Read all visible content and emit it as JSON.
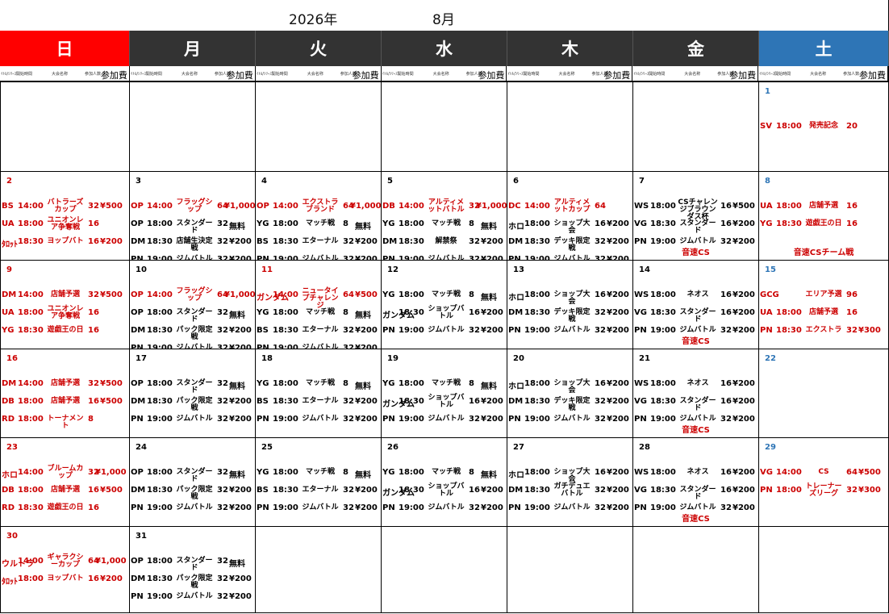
{
  "header": {
    "year": "2026年",
    "month": "8月"
  },
  "days": [
    {
      "label": "日",
      "style": "sun"
    },
    {
      "label": "月",
      "style": "wk"
    },
    {
      "label": "火",
      "style": "wk"
    },
    {
      "label": "水",
      "style": "wk"
    },
    {
      "label": "木",
      "style": "wk"
    },
    {
      "label": "金",
      "style": "wk"
    },
    {
      "label": "土",
      "style": "sat"
    }
  ],
  "subheader": {
    "c1": "ｲﾄﾙ/ｼﾘｰｽﾞ",
    "c2": "開始時間",
    "c3": "大会名称",
    "c4": "参加人数",
    "c5": "参加費"
  },
  "weeks": [
    [
      null,
      null,
      null,
      null,
      null,
      null,
      {
        "date": "1",
        "color": "blue",
        "events": [
          {
            "g": "SV",
            "t": "18:00",
            "n": "発売記念",
            "c": "20",
            "f": "",
            "color": "r"
          }
        ]
      }
    ],
    [
      {
        "date": "2",
        "color": "red",
        "events": [
          {
            "g": "BS",
            "t": "14:00",
            "n": "バトラーズカップ",
            "c": "32",
            "f": "¥500",
            "color": "r"
          },
          {
            "g": "UA",
            "t": "18:00",
            "n": "ユニオンレア争奪戦",
            "c": "16",
            "f": "",
            "color": "r"
          },
          {
            "g": "ﾀﾛｯﾄ",
            "t": "18:30",
            "n": "ヨップバト",
            "c": "16",
            "f": "¥200",
            "color": "r"
          }
        ]
      },
      {
        "date": "3",
        "color": "",
        "events": [
          {
            "g": "OP",
            "t": "14:00",
            "n": "フラッグシップ",
            "c": "64",
            "f": "¥1,000",
            "color": "r"
          },
          {
            "g": "OP",
            "t": "18:00",
            "n": "スタンダード",
            "c": "32",
            "f": "無料",
            "color": "k"
          },
          {
            "g": "DM",
            "t": "18:30",
            "n": "店舗生決定戦",
            "c": "32",
            "f": "¥200",
            "color": "k"
          },
          {
            "g": "PN",
            "t": "19:00",
            "n": "ジムバトル",
            "c": "32",
            "f": "¥200",
            "color": "k"
          }
        ]
      },
      {
        "date": "4",
        "color": "",
        "events": [
          {
            "g": "OP",
            "t": "14:00",
            "n": "エクストラブランド",
            "c": "64",
            "f": "¥1,000",
            "color": "r"
          },
          {
            "g": "YG",
            "t": "18:00",
            "n": "マッチ戦",
            "c": "8",
            "f": "無料",
            "color": "k"
          },
          {
            "g": "BS",
            "t": "18:30",
            "n": "エターナル",
            "c": "32",
            "f": "¥200",
            "color": "k"
          },
          {
            "g": "PN",
            "t": "19:00",
            "n": "ジムバトル",
            "c": "32",
            "f": "¥200",
            "color": "k"
          }
        ]
      },
      {
        "date": "5",
        "color": "",
        "events": [
          {
            "g": "DB",
            "t": "14:00",
            "n": "アルティメットバトル",
            "c": "32",
            "f": "¥1,000",
            "color": "r"
          },
          {
            "g": "YG",
            "t": "18:00",
            "n": "マッチ戦",
            "c": "8",
            "f": "無料",
            "color": "k"
          },
          {
            "g": "DM",
            "t": "18:30",
            "n": "解禁祭",
            "c": "32",
            "f": "¥200",
            "color": "k"
          },
          {
            "g": "PN",
            "t": "19:00",
            "n": "ジムバトル",
            "c": "32",
            "f": "¥200",
            "color": "k"
          }
        ]
      },
      {
        "date": "6",
        "color": "",
        "events": [
          {
            "g": "DC",
            "t": "14:00",
            "n": "アルティメットカップ",
            "c": "64",
            "f": "",
            "color": "r"
          },
          {
            "g": "ホロ",
            "t": "18:00",
            "n": "ショップ大会",
            "c": "16",
            "f": "¥200",
            "color": "k"
          },
          {
            "g": "DM",
            "t": "18:30",
            "n": "デッキ限定戦",
            "c": "32",
            "f": "¥200",
            "color": "k"
          },
          {
            "g": "PN",
            "t": "19:00",
            "n": "ジムバトル",
            "c": "32",
            "f": "¥200",
            "color": "k"
          }
        ]
      },
      {
        "date": "7",
        "color": "",
        "events": [
          {
            "g": "WS",
            "t": "18:00",
            "n": "CSチャレンジブラウンダス杯",
            "c": "16",
            "f": "¥500",
            "color": "k"
          },
          {
            "g": "VG",
            "t": "18:30",
            "n": "スタンダード",
            "c": "16",
            "f": "¥200",
            "color": "k"
          },
          {
            "g": "PN",
            "t": "19:00",
            "n": "ジムバトル",
            "c": "32",
            "f": "¥200",
            "color": "k"
          }
        ],
        "note": "音速CS"
      },
      {
        "date": "8",
        "color": "blue",
        "events": [
          {
            "g": "UA",
            "t": "18:00",
            "n": "店舗予選",
            "c": "16",
            "f": "",
            "color": "r"
          },
          {
            "g": "YG",
            "t": "18:30",
            "n": "遊戯王の日",
            "c": "16",
            "f": "",
            "color": "r"
          }
        ],
        "note": "音速CSチーム戦"
      }
    ],
    [
      {
        "date": "9",
        "color": "red",
        "events": [
          {
            "g": "DM",
            "t": "14:00",
            "n": "店舗予選",
            "c": "32",
            "f": "¥500",
            "color": "r"
          },
          {
            "g": "UA",
            "t": "18:00",
            "n": "ユニオンレア争奪戦",
            "c": "16",
            "f": "",
            "color": "r"
          },
          {
            "g": "YG",
            "t": "18:30",
            "n": "遊戯王の日",
            "c": "16",
            "f": "",
            "color": "r"
          }
        ]
      },
      {
        "date": "10",
        "color": "",
        "events": [
          {
            "g": "OP",
            "t": "14:00",
            "n": "フラッグシップ",
            "c": "64",
            "f": "¥1,000",
            "color": "r"
          },
          {
            "g": "OP",
            "t": "18:00",
            "n": "スタンダード",
            "c": "32",
            "f": "無料",
            "color": "k"
          },
          {
            "g": "DM",
            "t": "18:30",
            "n": "パック限定戦",
            "c": "32",
            "f": "¥200",
            "color": "k"
          },
          {
            "g": "PN",
            "t": "19:00",
            "n": "ジムバトル",
            "c": "32",
            "f": "¥200",
            "color": "k"
          }
        ]
      },
      {
        "date": "11",
        "color": "red",
        "events": [
          {
            "g": "ガンダム",
            "t": "14:00",
            "n": "ニュータイプチャレンジ",
            "c": "64",
            "f": "¥500",
            "color": "r"
          },
          {
            "g": "YG",
            "t": "18:00",
            "n": "マッチ戦",
            "c": "8",
            "f": "無料",
            "color": "k"
          },
          {
            "g": "BS",
            "t": "18:30",
            "n": "エターナル",
            "c": "32",
            "f": "¥200",
            "color": "k"
          },
          {
            "g": "PN",
            "t": "19:00",
            "n": "ジムバトル",
            "c": "32",
            "f": "¥200",
            "color": "k"
          }
        ]
      },
      {
        "date": "12",
        "color": "",
        "events": [
          {
            "g": "YG",
            "t": "18:00",
            "n": "マッチ戦",
            "c": "8",
            "f": "無料",
            "color": "k"
          },
          {
            "g": "ガンダム",
            "t": "18:30",
            "n": "ショップバトル",
            "c": "16",
            "f": "¥200",
            "color": "k"
          },
          {
            "g": "PN",
            "t": "19:00",
            "n": "ジムバトル",
            "c": "32",
            "f": "¥200",
            "color": "k"
          }
        ]
      },
      {
        "date": "13",
        "color": "",
        "events": [
          {
            "g": "ホロ",
            "t": "18:00",
            "n": "ショップ大会",
            "c": "16",
            "f": "¥200",
            "color": "k"
          },
          {
            "g": "DM",
            "t": "18:30",
            "n": "デッキ限定戦",
            "c": "32",
            "f": "¥200",
            "color": "k"
          },
          {
            "g": "PN",
            "t": "19:00",
            "n": "ジムバトル",
            "c": "32",
            "f": "¥200",
            "color": "k"
          }
        ]
      },
      {
        "date": "14",
        "color": "",
        "events": [
          {
            "g": "WS",
            "t": "18:00",
            "n": "ネオス",
            "c": "16",
            "f": "¥200",
            "color": "k"
          },
          {
            "g": "VG",
            "t": "18:30",
            "n": "スタンダード",
            "c": "16",
            "f": "¥200",
            "color": "k"
          },
          {
            "g": "PN",
            "t": "19:00",
            "n": "ジムバトル",
            "c": "32",
            "f": "¥200",
            "color": "k"
          }
        ],
        "note": "音速CS"
      },
      {
        "date": "15",
        "color": "blue",
        "events": [
          {
            "g": "GCG",
            "t": "",
            "n": "エリア予選",
            "c": "96",
            "f": "",
            "color": "r"
          },
          {
            "g": "UA",
            "t": "18:00",
            "n": "店舗予選",
            "c": "16",
            "f": "",
            "color": "r"
          },
          {
            "g": "PN",
            "t": "18:30",
            "n": "エクストラ",
            "c": "32",
            "f": "¥300",
            "color": "r"
          }
        ]
      }
    ],
    [
      {
        "date": "16",
        "color": "red",
        "events": [
          {
            "g": "DM",
            "t": "14:00",
            "n": "店舗予選",
            "c": "32",
            "f": "¥500",
            "color": "r"
          },
          {
            "g": "DB",
            "t": "18:00",
            "n": "店舗予選",
            "c": "16",
            "f": "¥500",
            "color": "r"
          },
          {
            "g": "RD",
            "t": "18:00",
            "n": "トーナメント",
            "c": "8",
            "f": "",
            "color": "r"
          }
        ]
      },
      {
        "date": "17",
        "color": "",
        "events": [
          {
            "g": "OP",
            "t": "18:00",
            "n": "スタンダード",
            "c": "32",
            "f": "無料",
            "color": "k"
          },
          {
            "g": "DM",
            "t": "18:30",
            "n": "パック限定戦",
            "c": "32",
            "f": "¥200",
            "color": "k"
          },
          {
            "g": "PN",
            "t": "19:00",
            "n": "ジムバトル",
            "c": "32",
            "f": "¥200",
            "color": "k"
          }
        ]
      },
      {
        "date": "18",
        "color": "",
        "events": [
          {
            "g": "YG",
            "t": "18:00",
            "n": "マッチ戦",
            "c": "8",
            "f": "無料",
            "color": "k"
          },
          {
            "g": "BS",
            "t": "18:30",
            "n": "エターナル",
            "c": "32",
            "f": "¥200",
            "color": "k"
          },
          {
            "g": "PN",
            "t": "19:00",
            "n": "ジムバトル",
            "c": "32",
            "f": "¥200",
            "color": "k"
          }
        ]
      },
      {
        "date": "19",
        "color": "",
        "events": [
          {
            "g": "YG",
            "t": "18:00",
            "n": "マッチ戦",
            "c": "8",
            "f": "無料",
            "color": "k"
          },
          {
            "g": "ガンダム",
            "t": "18:30",
            "n": "ショップバトル",
            "c": "16",
            "f": "¥200",
            "color": "k"
          },
          {
            "g": "PN",
            "t": "19:00",
            "n": "ジムバトル",
            "c": "32",
            "f": "¥200",
            "color": "k"
          }
        ]
      },
      {
        "date": "20",
        "color": "",
        "events": [
          {
            "g": "ホロ",
            "t": "18:00",
            "n": "ショップ大会",
            "c": "16",
            "f": "¥200",
            "color": "k"
          },
          {
            "g": "DM",
            "t": "18:30",
            "n": "デッキ限定戦",
            "c": "32",
            "f": "¥200",
            "color": "k"
          },
          {
            "g": "PN",
            "t": "19:00",
            "n": "ジムバトル",
            "c": "32",
            "f": "¥200",
            "color": "k"
          }
        ]
      },
      {
        "date": "21",
        "color": "",
        "events": [
          {
            "g": "WS",
            "t": "18:00",
            "n": "ネオス",
            "c": "16",
            "f": "¥200",
            "color": "k"
          },
          {
            "g": "VG",
            "t": "18:30",
            "n": "スタンダード",
            "c": "16",
            "f": "¥200",
            "color": "k"
          },
          {
            "g": "PN",
            "t": "19:00",
            "n": "ジムバトル",
            "c": "32",
            "f": "¥200",
            "color": "k"
          }
        ],
        "note": "音速CS"
      },
      {
        "date": "22",
        "color": "blue",
        "events": []
      }
    ],
    [
      {
        "date": "23",
        "color": "red",
        "events": [
          {
            "g": "ホロ",
            "t": "14:00",
            "n": "ブルームカップ",
            "c": "32",
            "f": "¥1,000",
            "color": "r"
          },
          {
            "g": "DB",
            "t": "18:00",
            "n": "店舗予選",
            "c": "16",
            "f": "¥500",
            "color": "r"
          },
          {
            "g": "RD",
            "t": "18:30",
            "n": "遊戯王の日",
            "c": "16",
            "f": "",
            "color": "r"
          }
        ]
      },
      {
        "date": "24",
        "color": "",
        "events": [
          {
            "g": "OP",
            "t": "18:00",
            "n": "スタンダード",
            "c": "32",
            "f": "無料",
            "color": "k"
          },
          {
            "g": "DM",
            "t": "18:30",
            "n": "パック限定戦",
            "c": "32",
            "f": "¥200",
            "color": "k"
          },
          {
            "g": "PN",
            "t": "19:00",
            "n": "ジムバトル",
            "c": "32",
            "f": "¥200",
            "color": "k"
          }
        ]
      },
      {
        "date": "25",
        "color": "",
        "events": [
          {
            "g": "YG",
            "t": "18:00",
            "n": "マッチ戦",
            "c": "8",
            "f": "無料",
            "color": "k"
          },
          {
            "g": "BS",
            "t": "18:30",
            "n": "エターナル",
            "c": "32",
            "f": "¥200",
            "color": "k"
          },
          {
            "g": "PN",
            "t": "19:00",
            "n": "ジムバトル",
            "c": "32",
            "f": "¥200",
            "color": "k"
          }
        ]
      },
      {
        "date": "26",
        "color": "",
        "events": [
          {
            "g": "YG",
            "t": "18:00",
            "n": "マッチ戦",
            "c": "8",
            "f": "無料",
            "color": "k"
          },
          {
            "g": "ガンダム",
            "t": "18:30",
            "n": "ショップバトル",
            "c": "16",
            "f": "¥200",
            "color": "k"
          },
          {
            "g": "PN",
            "t": "19:00",
            "n": "ジムバトル",
            "c": "32",
            "f": "¥200",
            "color": "k"
          }
        ]
      },
      {
        "date": "27",
        "color": "",
        "events": [
          {
            "g": "ホロ",
            "t": "18:00",
            "n": "ショップ大会",
            "c": "16",
            "f": "¥200",
            "color": "k"
          },
          {
            "g": "DM",
            "t": "18:30",
            "n": "ガチデュエバトル",
            "c": "32",
            "f": "¥200",
            "color": "k"
          },
          {
            "g": "PN",
            "t": "19:00",
            "n": "ジムバトル",
            "c": "32",
            "f": "¥200",
            "color": "k"
          }
        ]
      },
      {
        "date": "28",
        "color": "",
        "events": [
          {
            "g": "WS",
            "t": "18:00",
            "n": "ネオス",
            "c": "16",
            "f": "¥200",
            "color": "k"
          },
          {
            "g": "VG",
            "t": "18:30",
            "n": "スタンダード",
            "c": "16",
            "f": "¥200",
            "color": "k"
          },
          {
            "g": "PN",
            "t": "19:00",
            "n": "ジムバトル",
            "c": "32",
            "f": "¥200",
            "color": "k"
          }
        ],
        "note": "音速CS"
      },
      {
        "date": "29",
        "color": "blue",
        "events": [
          {
            "g": "VG",
            "t": "14:00",
            "n": "CS",
            "c": "64",
            "f": "¥500",
            "color": "r"
          },
          {
            "g": "PN",
            "t": "18:00",
            "n": "トレーナーズリーグ",
            "c": "32",
            "f": "¥300",
            "color": "r"
          }
        ]
      }
    ],
    [
      {
        "date": "30",
        "color": "red",
        "events": [
          {
            "g": "ウルトラ",
            "t": "14:00",
            "n": "ギャラクシーカップ",
            "c": "64",
            "f": "¥1,000",
            "color": "r"
          },
          {
            "g": "ﾀﾛｯﾄ",
            "t": "18:00",
            "n": "ヨップバト",
            "c": "16",
            "f": "¥200",
            "color": "r"
          }
        ]
      },
      {
        "date": "31",
        "color": "",
        "events": [
          {
            "g": "OP",
            "t": "18:00",
            "n": "スタンダード",
            "c": "32",
            "f": "無料",
            "color": "k"
          },
          {
            "g": "DM",
            "t": "18:30",
            "n": "パック限定戦",
            "c": "32",
            "f": "¥200",
            "color": "k"
          },
          {
            "g": "PN",
            "t": "19:00",
            "n": "ジムバトル",
            "c": "32",
            "f": "¥200",
            "color": "k"
          }
        ]
      },
      null,
      null,
      null,
      null,
      null
    ]
  ]
}
